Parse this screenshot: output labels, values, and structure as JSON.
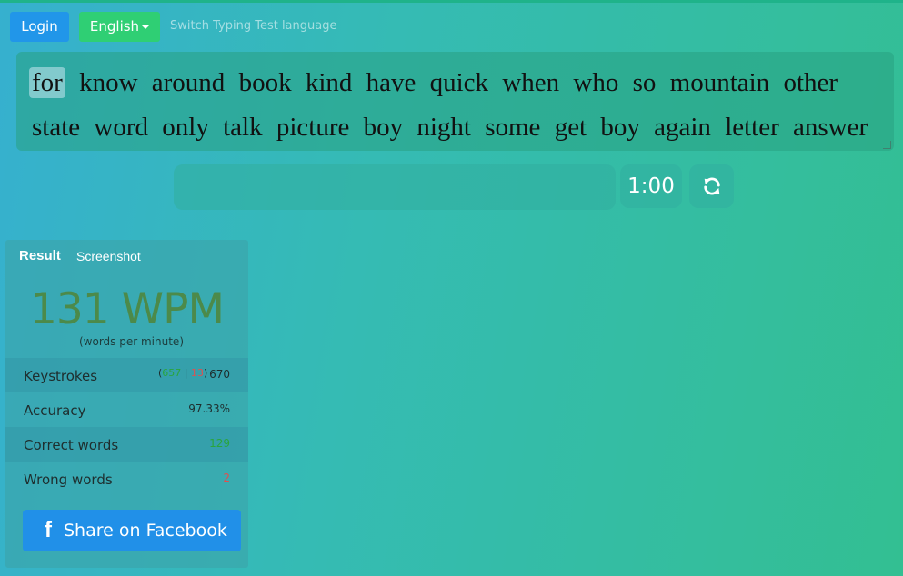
{
  "header": {
    "login_label": "Login",
    "language_label": "English",
    "language_hint": "Switch Typing Test language"
  },
  "test": {
    "words": [
      "for",
      "know",
      "around",
      "book",
      "kind",
      "have",
      "quick",
      "when",
      "who",
      "so",
      "mountain",
      "other",
      "state",
      "word",
      "only",
      "talk",
      "picture",
      "boy",
      "night",
      "some",
      "get",
      "boy",
      "again",
      "letter",
      "answer"
    ],
    "current_word_index": 0,
    "input_value": "",
    "timer": "1:00"
  },
  "result": {
    "tab_result": "Result",
    "tab_screenshot": "Screenshot",
    "wpm": "131 WPM",
    "wpm_sub": "(words per minute)",
    "keystrokes_label": "Keystrokes",
    "keystrokes_correct": "657",
    "keystrokes_wrong": "13",
    "keystrokes_total": "670",
    "accuracy_label": "Accuracy",
    "accuracy_value": "97.33%",
    "correct_words_label": "Correct words",
    "correct_words_value": "129",
    "wrong_words_label": "Wrong words",
    "wrong_words_value": "2",
    "share_label": "Share on Facebook",
    "share_icon": "f"
  },
  "colors": {
    "login_button": "#2196e9",
    "language_button": "#2fcf74",
    "wpm_text": "#4c8a4a",
    "correct": "#2aa53c",
    "wrong": "#e05050",
    "facebook": "#2190e8"
  }
}
